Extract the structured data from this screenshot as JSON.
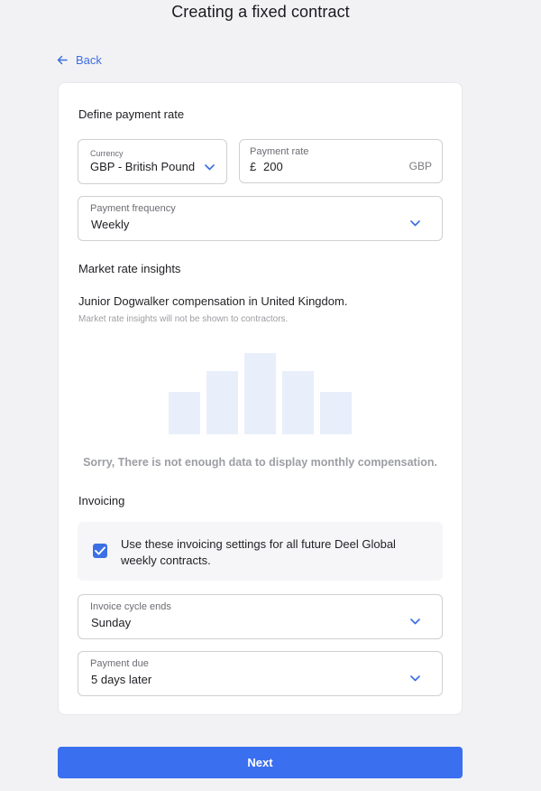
{
  "header": {
    "title": "Creating a fixed contract"
  },
  "nav": {
    "back_label": "Back"
  },
  "payment_rate": {
    "heading": "Define payment rate",
    "currency": {
      "label": "Currency",
      "value": "GBP - British Pound"
    },
    "rate": {
      "label": "Payment rate",
      "prefix": "£",
      "value": "200",
      "suffix": "GBP"
    },
    "frequency": {
      "label": "Payment frequency",
      "value": "Weekly"
    }
  },
  "market_insights": {
    "heading": "Market rate insights",
    "description": "Junior Dogwalker compensation in United Kingdom.",
    "note": "Market rate insights will not be shown to contractors.",
    "empty_message": "Sorry, There is not enough data to display monthly compensation."
  },
  "chart_data": {
    "type": "bar",
    "categories": [
      "",
      "",
      "",
      "",
      ""
    ],
    "values": [
      0.52,
      0.78,
      1.0,
      0.78,
      0.52
    ],
    "bar_color": "#e8effb",
    "title": "",
    "xlabel": "",
    "ylabel": ""
  },
  "invoicing": {
    "heading": "Invoicing",
    "checkbox_checked": true,
    "checkbox_text": "Use these invoicing settings for all future Deel Global weekly contracts.",
    "cycle_end": {
      "label": "Invoice cycle ends",
      "value": "Sunday"
    },
    "payment_due": {
      "label": "Payment due",
      "value": "5 days later"
    }
  },
  "footer": {
    "next_label": "Next"
  },
  "colors": {
    "accent": "#3a6ff0",
    "link": "#3e6fe0",
    "background": "#f2f2f4",
    "card": "#ffffff"
  },
  "icons": {
    "back": "arrow-left-icon",
    "dropdown": "chevron-down-icon",
    "check": "checkmark-icon"
  }
}
